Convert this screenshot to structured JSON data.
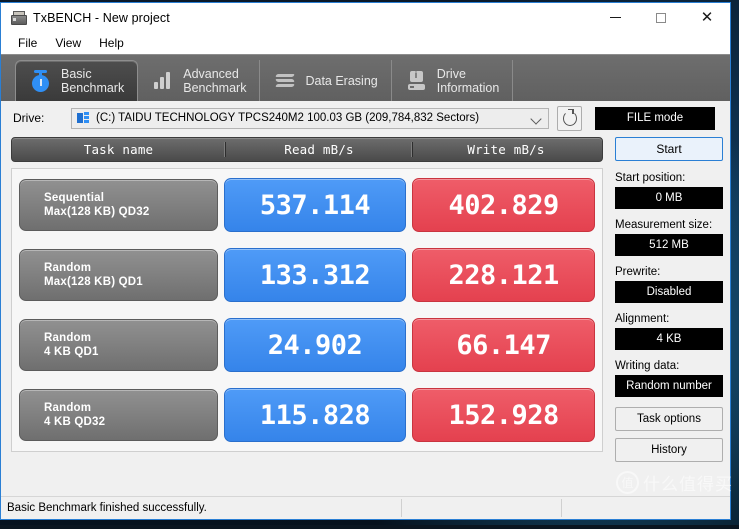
{
  "window": {
    "title": "TxBENCH - New project",
    "icon": "drive-icon",
    "controls": {
      "minimize": "minimize-icon",
      "maximize": "maximize-icon",
      "close": "close-icon"
    }
  },
  "menubar": {
    "items": [
      "File",
      "View",
      "Help"
    ]
  },
  "tabs": [
    {
      "line1": "Basic",
      "line2": "Benchmark",
      "icon": "stopwatch-icon",
      "active": true
    },
    {
      "line1": "Advanced",
      "line2": "Benchmark",
      "icon": "bar-chart-icon",
      "active": false
    },
    {
      "line1": "Data Erasing",
      "line2": "",
      "icon": "shredder-icon",
      "active": false
    },
    {
      "line1": "Drive",
      "line2": "Information",
      "icon": "drive-info-icon",
      "active": false
    }
  ],
  "drive": {
    "label": "Drive:",
    "selected": "(C:) TAIDU TECHNOLOGY TPCS240M2  100.03 GB (209,784,832 Sectors)",
    "refresh_icon": "refresh-icon",
    "mode_button": "FILE mode"
  },
  "table": {
    "headers": [
      "Task name",
      "Read mB/s",
      "Write mB/s"
    ],
    "rows": [
      {
        "name_line1": "Sequential",
        "name_line2": "Max(128 KB) QD32",
        "read": "537.114",
        "write": "402.829"
      },
      {
        "name_line1": "Random",
        "name_line2": "Max(128 KB) QD1",
        "read": "133.312",
        "write": "228.121"
      },
      {
        "name_line1": "Random",
        "name_line2": "4 KB QD1",
        "read": "24.902",
        "write": "66.147"
      },
      {
        "name_line1": "Random",
        "name_line2": "4 KB QD32",
        "read": "115.828",
        "write": "152.928"
      }
    ]
  },
  "panel": {
    "start_button": "Start",
    "fields": [
      {
        "label": "Start position:",
        "value": "0 MB"
      },
      {
        "label": "Measurement size:",
        "value": "512 MB"
      },
      {
        "label": "Prewrite:",
        "value": "Disabled"
      },
      {
        "label": "Alignment:",
        "value": "4 KB"
      },
      {
        "label": "Writing data:",
        "value": "Random number"
      }
    ],
    "task_options_button": "Task options",
    "history_button": "History"
  },
  "statusbar": {
    "message": "Basic Benchmark finished successfully."
  },
  "watermark": {
    "mark": "值",
    "text": "什么值得买"
  },
  "colors": {
    "read_blue": "#3584ea",
    "write_red": "#e4414f",
    "tabstrip_gray": "#666666",
    "accent_border": "#2a7fd4"
  }
}
